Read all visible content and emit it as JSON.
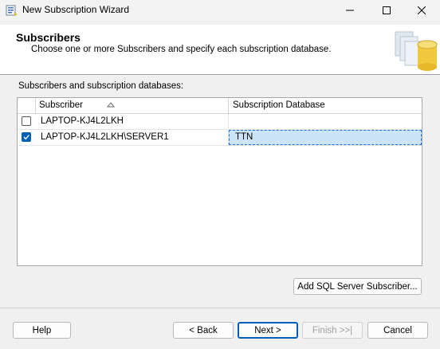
{
  "window": {
    "title": "New Subscription Wizard",
    "controls": [
      "minimize-icon",
      "maximize-icon",
      "close-icon"
    ]
  },
  "header": {
    "title": "Subscribers",
    "description": "Choose one or more Subscribers and specify each subscription database."
  },
  "grid": {
    "label": "Subscribers and subscription databases:",
    "columns": {
      "subscriber": "Subscriber",
      "database": "Subscription Database"
    },
    "sort": "ascending",
    "rows": [
      {
        "checked": false,
        "subscriber": "LAPTOP-KJ4L2LKH",
        "database": ""
      },
      {
        "checked": true,
        "subscriber": "LAPTOP-KJ4L2LKH\\SERVER1",
        "database": "TTN"
      }
    ]
  },
  "buttons": {
    "add_subscriber": "Add SQL Server Subscriber...",
    "help": "Help",
    "back": "< Back",
    "next": "Next >",
    "finish": "Finish >>|",
    "cancel": "Cancel"
  },
  "colors": {
    "accent": "#005fb8",
    "selection": "#cce4f7"
  }
}
